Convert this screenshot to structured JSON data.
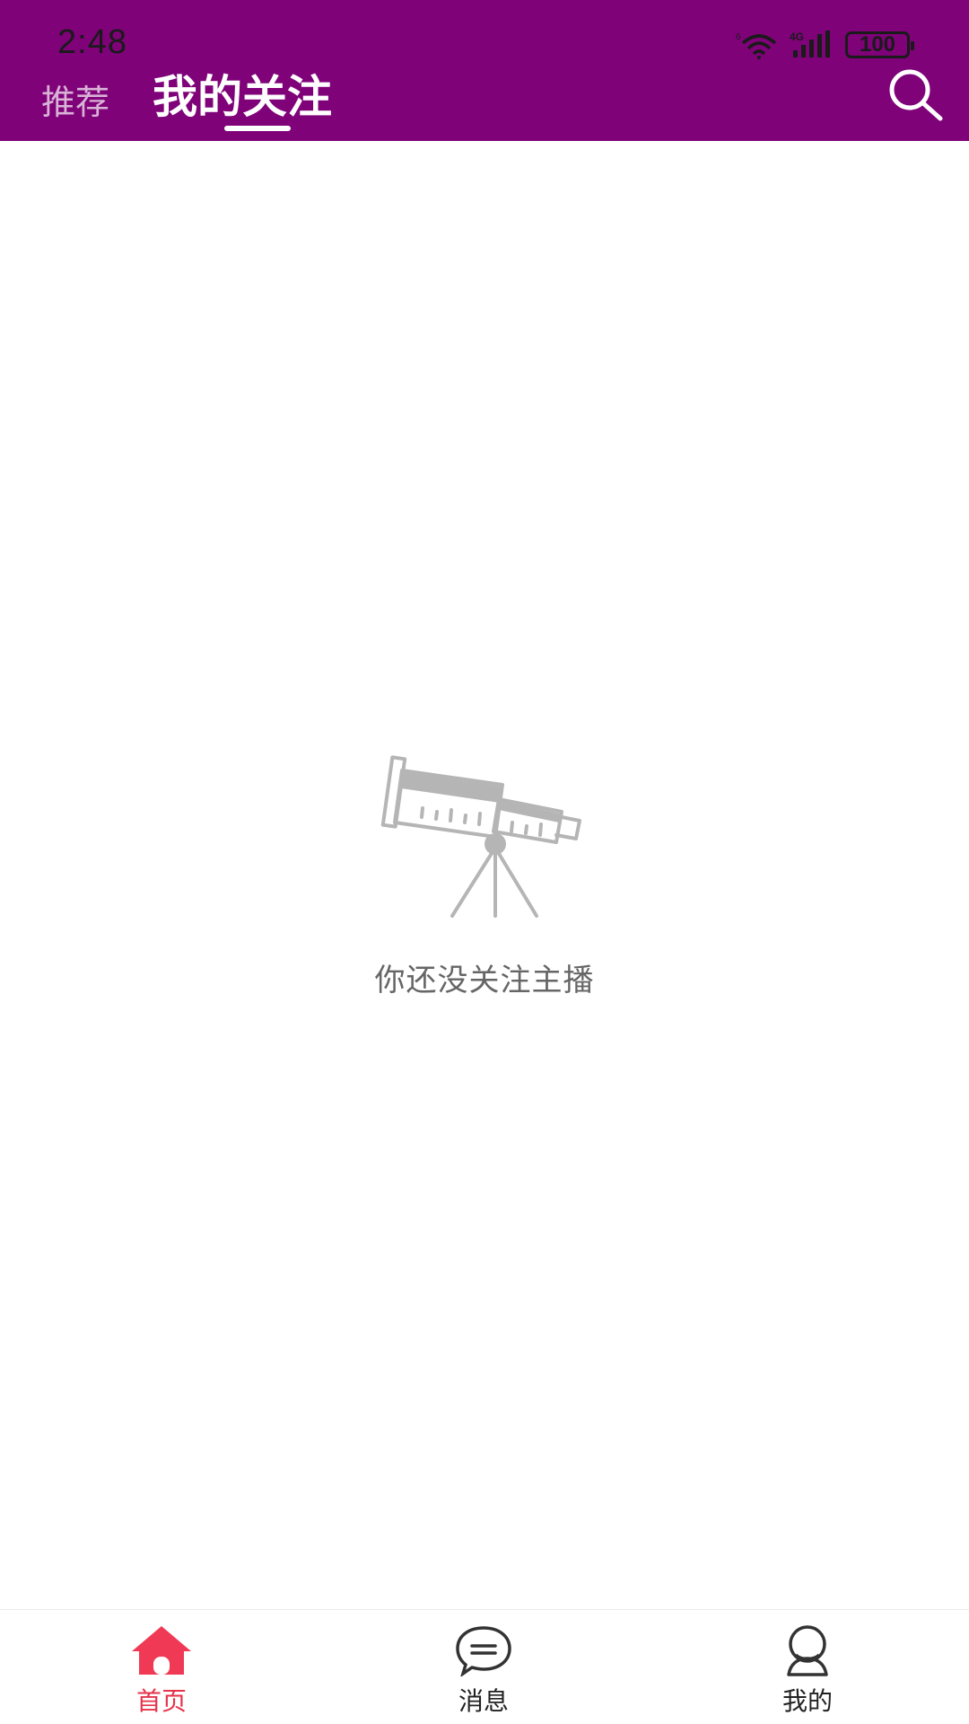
{
  "status_bar": {
    "time": "2:48",
    "battery": "100",
    "network": "4G",
    "wifi_badge": "6"
  },
  "header": {
    "tabs": [
      {
        "label": "推荐",
        "active": false
      },
      {
        "label": "我的关注",
        "active": true
      }
    ],
    "search_icon": "search-icon",
    "background_color": "#7f0279"
  },
  "empty_state": {
    "icon": "telescope-icon",
    "message": "你还没关注主播"
  },
  "bottom_nav": {
    "items": [
      {
        "label": "首页",
        "icon": "home-icon",
        "active": true
      },
      {
        "label": "消息",
        "icon": "chat-bubble-icon",
        "active": false
      },
      {
        "label": "我的",
        "icon": "profile-icon",
        "active": false
      }
    ],
    "active_color": "#e6334a"
  }
}
